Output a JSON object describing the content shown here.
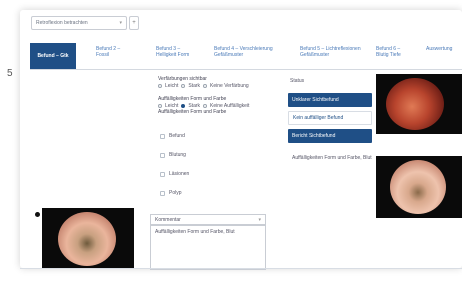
{
  "search": {
    "value": "Retroflexion betrachten",
    "add_label": "+"
  },
  "tabs": [
    {
      "label": "Befund – Gtk"
    },
    {
      "label": "Befund 2 – Fossil"
    },
    {
      "label": "Befund 3 – Helligkeit Form"
    },
    {
      "label": "Befund 4 – Verschleierung Gefäßmuster"
    },
    {
      "label": "Befund 5 – Lichtreflexionen Gefäßmuster"
    },
    {
      "label": "Befund 6 – Blutig Tiefe"
    },
    {
      "label": "Auswertung"
    }
  ],
  "question1": {
    "title": "Verfärbungen sichtbar",
    "options": [
      "Leicht",
      "Stark",
      "Keine Verfärbung"
    ]
  },
  "question2": {
    "title": "Auffälligkeiten Form und Farbe",
    "options": [
      "Leicht",
      "Stark",
      "Keine Auffälligkeit"
    ],
    "selected": 1,
    "note": "Auffälligkeiten Form und Farbe"
  },
  "checkboxes": [
    "Befund",
    "Blutung",
    "Läsionen",
    "Polyp"
  ],
  "right_panel": {
    "label": "Status",
    "buttons": [
      "Unklarer Sichtbefund",
      "Kein auffälliger Befund",
      "Bericht Sichtbefund"
    ],
    "extra_text": "Auffälligkeiten Form und Farbe, Blut"
  },
  "comment": {
    "header": "Kommentar",
    "text": "Auffälligkeiten Form und Farbe, Blut"
  },
  "colors": {
    "accent": "#1f4f86",
    "link": "#4a7ab8"
  }
}
